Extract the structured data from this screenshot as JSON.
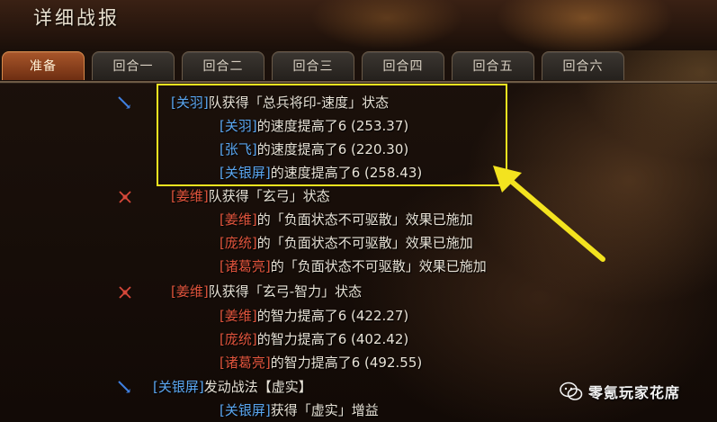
{
  "window": {
    "title": "详细战报"
  },
  "tabs": [
    {
      "label": "准备"
    },
    {
      "label": "回合一"
    },
    {
      "label": "回合二"
    },
    {
      "label": "回合三"
    },
    {
      "label": "回合四"
    },
    {
      "label": "回合五"
    },
    {
      "label": "回合六"
    }
  ],
  "log": [
    {
      "icon": "blue-spear-icon",
      "hero": "[关羽]",
      "text": "队获得「总兵将印-速度」状态"
    },
    {
      "hero": "[关羽]",
      "text": "的速度提高了6 (253.37)"
    },
    {
      "hero": "[张飞]",
      "text": "的速度提高了6 (220.30)"
    },
    {
      "hero": "[关银屏]",
      "text": "的速度提高了6 (258.43)"
    },
    {
      "icon": "red-swords-icon",
      "hero": "[姜维]",
      "text": "队获得「玄弓」状态"
    },
    {
      "hero": "[姜维]",
      "text": "的「负面状态不可驱散」效果已施加"
    },
    {
      "hero": "[庞统]",
      "text": "的「负面状态不可驱散」效果已施加"
    },
    {
      "hero": "[诸葛亮]",
      "text": "的「负面状态不可驱散」效果已施加"
    },
    {
      "icon": "red-swords-icon",
      "hero": "[姜维]",
      "text": "队获得「玄弓-智力」状态"
    },
    {
      "hero": "[姜维]",
      "text": "的智力提高了6 (422.27)"
    },
    {
      "hero": "[庞统]",
      "text": "的智力提高了6 (402.42)"
    },
    {
      "hero": "[诸葛亮]",
      "text": "的智力提高了6 (492.55)"
    },
    {
      "icon": "blue-spear-icon",
      "hero": "[关银屏]",
      "text": "发动战法【虚实】"
    },
    {
      "hero": "[关银屏]",
      "text": "获得「虚实」增益"
    }
  ],
  "watermark": {
    "text": "零氪玩家花席"
  },
  "colors": {
    "ally": "#5aa6f0",
    "enemy": "#e0543c",
    "highlight": "#f3e31f",
    "tab_active": "#a8562a"
  }
}
